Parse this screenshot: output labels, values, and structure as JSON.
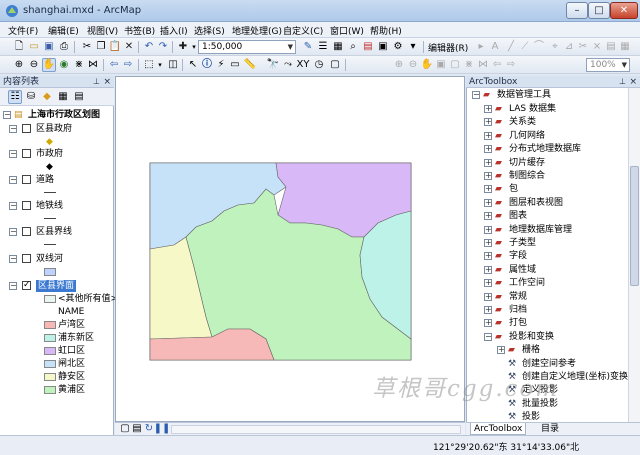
{
  "window": {
    "title": "shanghai.mxd - ArcMap"
  },
  "menu": [
    "文件(F)",
    "编辑(E)",
    "视图(V)",
    "书签(B)",
    "插入(I)",
    "选择(S)",
    "地理处理(G)",
    "自定义(C)",
    "窗口(W)",
    "帮助(H)"
  ],
  "toolbar": {
    "scale": "1:50,000",
    "editor_label": "编辑器(R)",
    "zoom": "100%"
  },
  "toc": {
    "title": "内容列表",
    "map_name": "上海市行政区划图",
    "layers": [
      {
        "name": "区县政府",
        "checked": false
      },
      {
        "name": "市政府",
        "checked": false
      },
      {
        "name": "道路",
        "checked": false
      },
      {
        "name": "地铁线",
        "checked": false
      },
      {
        "name": "区县界线",
        "checked": false
      },
      {
        "name": "双线河",
        "checked": false
      },
      {
        "name": "区县界面",
        "checked": true
      }
    ],
    "legend": {
      "other": "<其他所有值>",
      "field": "NAME",
      "classes": [
        {
          "name": "卢湾区",
          "color": "#f7b9b7"
        },
        {
          "name": "浦东新区",
          "color": "#bdf2e8"
        },
        {
          "name": "虹口区",
          "color": "#d8b8f7"
        },
        {
          "name": "闸北区",
          "color": "#c6e2f9"
        },
        {
          "name": "静安区",
          "color": "#f7f8c8"
        },
        {
          "name": "黄浦区",
          "color": "#bff2bc"
        }
      ]
    }
  },
  "map": {
    "colors": {
      "luwan": "#f7b9b7",
      "pudong": "#bdf2e8",
      "hongkou": "#d8b8f7",
      "zhabei": "#c6e2f9",
      "jingan": "#f7f8c8",
      "huangpu": "#bff2bc"
    }
  },
  "toolbox": {
    "title": "ArcToolbox",
    "root": "数据管理工具",
    "items": [
      "LAS 数据集",
      "关系类",
      "几何网络",
      "分布式地理数据库",
      "切片缓存",
      "制图综合",
      "包",
      "图层和表视图",
      "图表",
      "地理数据库管理",
      "子类型",
      "字段",
      "属性域",
      "工作空间",
      "常规",
      "归档",
      "打包"
    ],
    "open_item": "投影和变换",
    "children": [
      "栅格",
      "创建空间参考",
      "创建自定义地理(坐标)变换",
      "定义投影",
      "批量投影",
      "投影"
    ],
    "tabs": [
      "ArcToolbox",
      "目录"
    ]
  },
  "status": {
    "coords": "121°29'20.62\"东   31°14'33.06\"北"
  },
  "watermark": "草根哥cgg.com"
}
